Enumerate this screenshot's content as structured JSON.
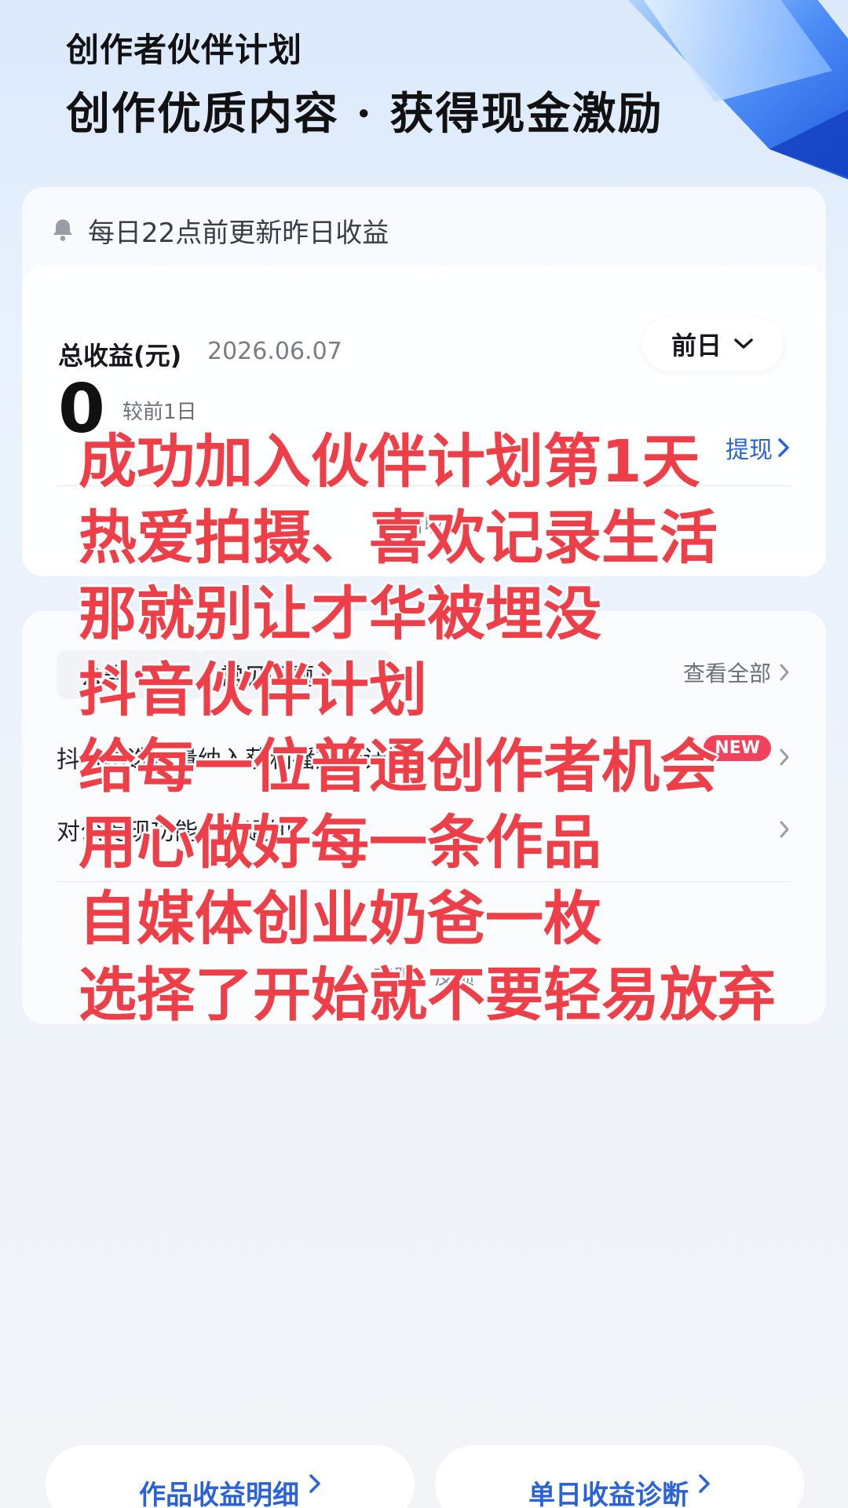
{
  "header": {
    "title": "创作者伙伴计划",
    "subtitle": "创作优质内容 · 获得现金激励"
  },
  "earnings": {
    "notice": "每日22点前更新昨日收益",
    "total_label": "总收益(元)",
    "date": "2026.06.07",
    "period_selected": "前日",
    "amount": "0",
    "compare_label": "较前1日",
    "withdraw_label": "提现",
    "view_income_label": "查看收益"
  },
  "info": {
    "tabs": [
      {
        "label": "公告"
      },
      {
        "label": "常见问题"
      }
    ],
    "view_all_label": "查看全部",
    "items": [
      {
        "title": "抖音精选流量纳入获利播放量计算",
        "badge": "NEW"
      },
      {
        "title": "对公提现功能上线通知"
      }
    ],
    "help_text": "客服」反馈"
  },
  "overlay_text": [
    "成功加入伙伴计划第1天",
    "热爱拍摄、喜欢记录生活",
    "那就别让才华被埋没",
    "抖音伙伴计划",
    "给每一位普通创作者机会",
    "用心做好每一条作品",
    "自媒体创业奶爸一枚",
    "选择了开始就不要轻易放弃"
  ],
  "bottom_actions": {
    "works_detail": "作品收益明细",
    "daily_diagnosis": "单日收益诊断"
  },
  "colors": {
    "accent_blue": "#2a62d9",
    "overlay_red": "#ee3e48",
    "badge_red": "#f2415a"
  }
}
